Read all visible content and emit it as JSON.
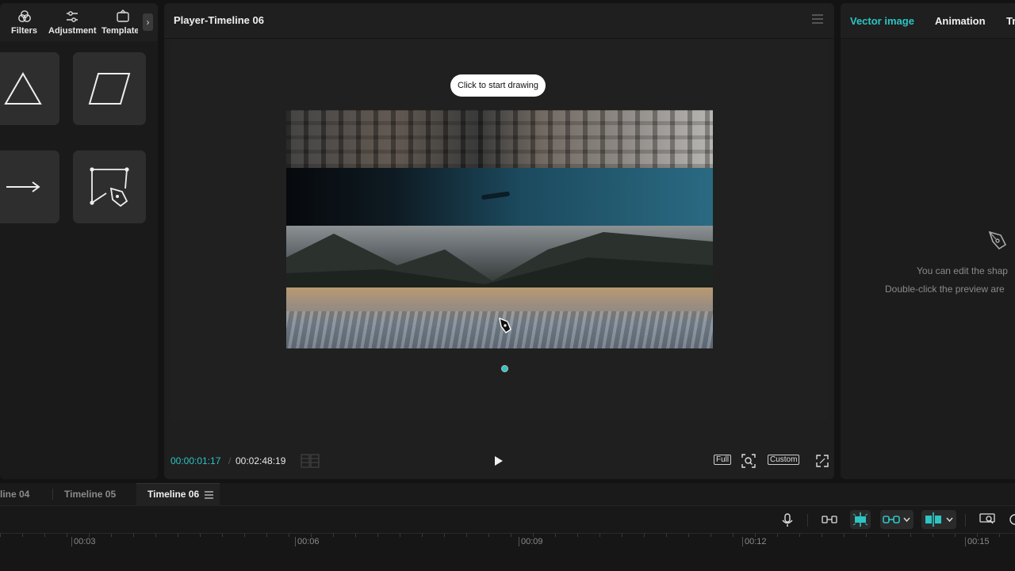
{
  "left_panel": {
    "tools": [
      {
        "label": "Filters",
        "icon": "filters-icon"
      },
      {
        "label": "Adjustment",
        "icon": "adjustment-icon"
      },
      {
        "label": "Template",
        "icon": "template-icon"
      }
    ],
    "shapes": [
      "triangle-shape",
      "parallelogram-shape",
      "arrow-shape",
      "pen-draw-shape"
    ]
  },
  "player": {
    "title": "Player-Timeline 06",
    "tooltip": "Click to start drawing",
    "current_time": "00:00:01:17",
    "separator": "/",
    "total_time": "00:02:48:19",
    "full_label": "Full",
    "custom_label": "Custom"
  },
  "right_panel": {
    "tabs": [
      "Vector image",
      "Animation",
      "Tr"
    ],
    "empty_line1": "You can edit the shap",
    "empty_line2": "Double-click the preview are"
  },
  "timeline": {
    "tabs": [
      "line 04",
      "Timeline 05",
      "Timeline 06"
    ],
    "ticks": [
      "00:03",
      "00:06",
      "00:09",
      "00:12",
      "00:15"
    ]
  },
  "colors": {
    "accent": "#2ec4c4",
    "panel": "#1f1f1f",
    "background": "#131313"
  }
}
